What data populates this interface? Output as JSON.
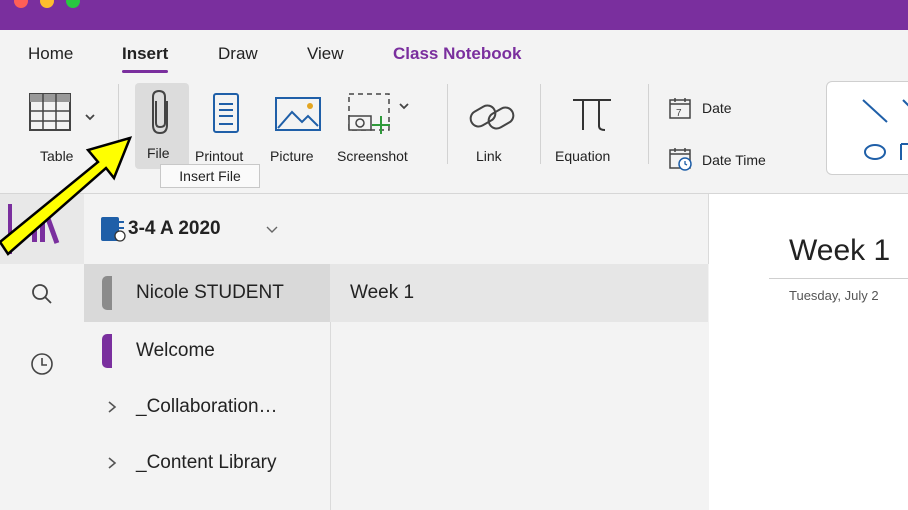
{
  "window": {
    "title_bar_color": "#7a2f9e",
    "accent": "#7a2f9e"
  },
  "tabs": [
    "Home",
    "Insert",
    "Draw",
    "View",
    "Class Notebook"
  ],
  "active_tab": "Insert",
  "ribbon": {
    "table": "Table",
    "file": "File",
    "printout": "Printout",
    "picture": "Picture",
    "screenshot": "Screenshot",
    "link": "Link",
    "equation": "Equation",
    "date": "Date",
    "date_time": "Date Time",
    "tooltip": "Insert File"
  },
  "notebook": {
    "name": "3-4 A 2020"
  },
  "sections": [
    {
      "label": "Nicole STUDENT",
      "color": "#8b8b8b",
      "selected": true
    },
    {
      "label": "Welcome",
      "color": "#7a2f9e",
      "selected": false
    },
    {
      "label": "_Collaboration…",
      "group": true
    },
    {
      "label": "_Content Library",
      "group": true
    }
  ],
  "pages": [
    {
      "label": "Week 1",
      "selected": true
    }
  ],
  "page": {
    "title": "Week 1",
    "date": "Tuesday, July 2"
  },
  "annotation": {
    "arrow_color": "#ffff00"
  },
  "icons": [
    "table-icon",
    "paperclip-icon",
    "printout-icon",
    "picture-icon",
    "screenshot-icon",
    "link-icon",
    "equation-icon",
    "date-icon",
    "date-time-icon",
    "notebooks-icon",
    "search-icon",
    "recent-icon",
    "notebook-icon",
    "chevron-down-icon",
    "chevron-right-icon"
  ]
}
